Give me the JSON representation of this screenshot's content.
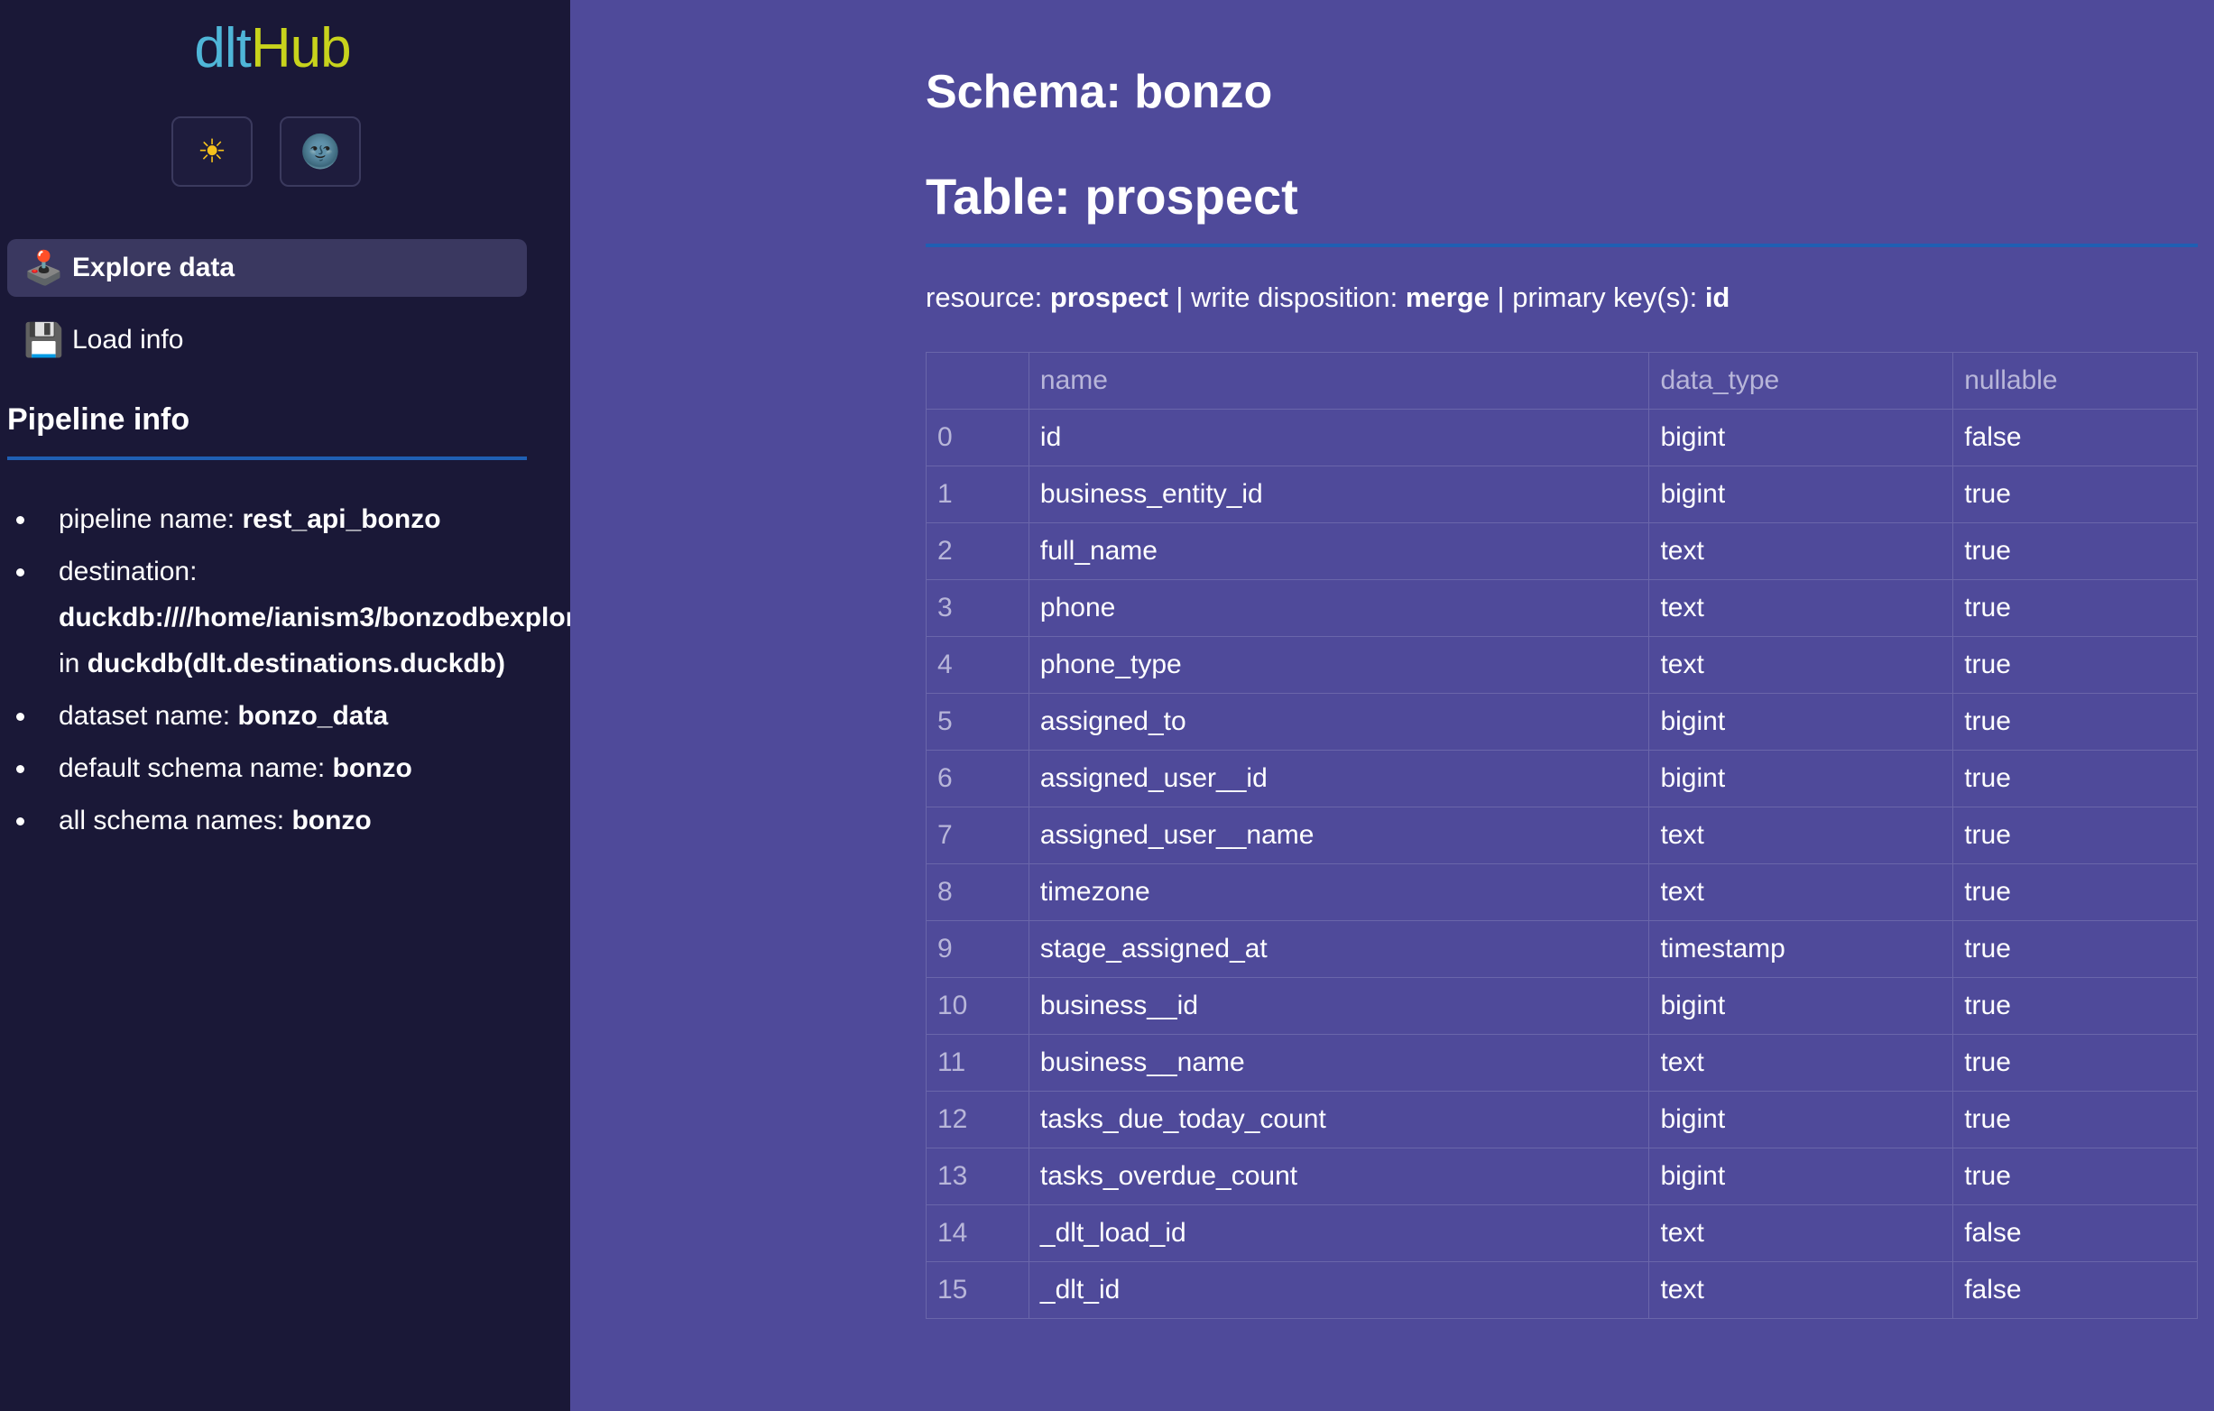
{
  "logo": {
    "part1": "dlt",
    "part2": "Hub"
  },
  "theme": {
    "light_icon": "☀",
    "dark_icon": "🌚"
  },
  "sidebar": {
    "nav": [
      {
        "label": "Explore data",
        "icon": "joystick-icon",
        "glyph": "🕹️",
        "active": true
      },
      {
        "label": "Load info",
        "icon": "floppy-disk-icon",
        "glyph": "💾",
        "active": false
      }
    ],
    "pipeline_title": "Pipeline info",
    "pipeline_info": {
      "pipeline_name_label": "pipeline name:",
      "pipeline_name": "rest_api_bonzo",
      "destination_label": "destination:",
      "destination_path": "duckdb:////home/ianism3/bonzodbexplor",
      "destination_in": "in",
      "destination_type": "duckdb(dlt.destinations.duckdb)",
      "dataset_name_label": "dataset name:",
      "dataset_name": "bonzo_data",
      "default_schema_label": "default schema name:",
      "default_schema": "bonzo",
      "all_schemas_label": "all schema names:",
      "all_schemas": "bonzo"
    }
  },
  "main": {
    "schema_title": "Schema: bonzo",
    "table_title": "Table: prospect",
    "meta": {
      "resource_label": "resource:",
      "resource": "prospect",
      "sep1": "|",
      "write_label": "write disposition:",
      "write": "merge",
      "sep2": "|",
      "pk_label": "primary key(s):",
      "pk": "id"
    },
    "table": {
      "headers": [
        "",
        "name",
        "data_type",
        "nullable"
      ],
      "rows": [
        [
          "0",
          "id",
          "bigint",
          "false"
        ],
        [
          "1",
          "business_entity_id",
          "bigint",
          "true"
        ],
        [
          "2",
          "full_name",
          "text",
          "true"
        ],
        [
          "3",
          "phone",
          "text",
          "true"
        ],
        [
          "4",
          "phone_type",
          "text",
          "true"
        ],
        [
          "5",
          "assigned_to",
          "bigint",
          "true"
        ],
        [
          "6",
          "assigned_user__id",
          "bigint",
          "true"
        ],
        [
          "7",
          "assigned_user__name",
          "text",
          "true"
        ],
        [
          "8",
          "timezone",
          "text",
          "true"
        ],
        [
          "9",
          "stage_assigned_at",
          "timestamp",
          "true"
        ],
        [
          "10",
          "business__id",
          "bigint",
          "true"
        ],
        [
          "11",
          "business__name",
          "text",
          "true"
        ],
        [
          "12",
          "tasks_due_today_count",
          "bigint",
          "true"
        ],
        [
          "13",
          "tasks_overdue_count",
          "bigint",
          "true"
        ],
        [
          "14",
          "_dlt_load_id",
          "text",
          "false"
        ],
        [
          "15",
          "_dlt_id",
          "text",
          "false"
        ]
      ]
    }
  }
}
